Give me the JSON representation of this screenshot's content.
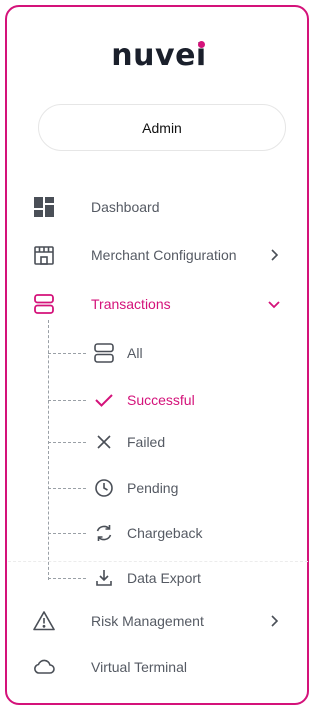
{
  "brand": {
    "logo_text": "nuvei",
    "accent": "#d4127a"
  },
  "user": {
    "role": "Admin"
  },
  "nav": {
    "dashboard": {
      "label": "Dashboard",
      "icon": "dashboard-icon"
    },
    "merchant": {
      "label": "Merchant Configuration",
      "icon": "store-icon"
    },
    "transactions": {
      "label": "Transactions",
      "icon": "transactions-icon",
      "expanded": true,
      "children": {
        "all": {
          "label": "All",
          "icon": "list-icon"
        },
        "successful": {
          "label": "Successful",
          "icon": "check-icon",
          "active": true
        },
        "failed": {
          "label": "Failed",
          "icon": "close-icon"
        },
        "pending": {
          "label": "Pending",
          "icon": "clock-icon"
        },
        "chargeback": {
          "label": "Chargeback",
          "icon": "refresh-icon"
        },
        "export": {
          "label": "Data Export",
          "icon": "download-icon"
        }
      }
    },
    "risk": {
      "label": "Risk Management",
      "icon": "warning-icon"
    },
    "terminal": {
      "label": "Virtual Terminal",
      "icon": "cloud-icon"
    }
  }
}
